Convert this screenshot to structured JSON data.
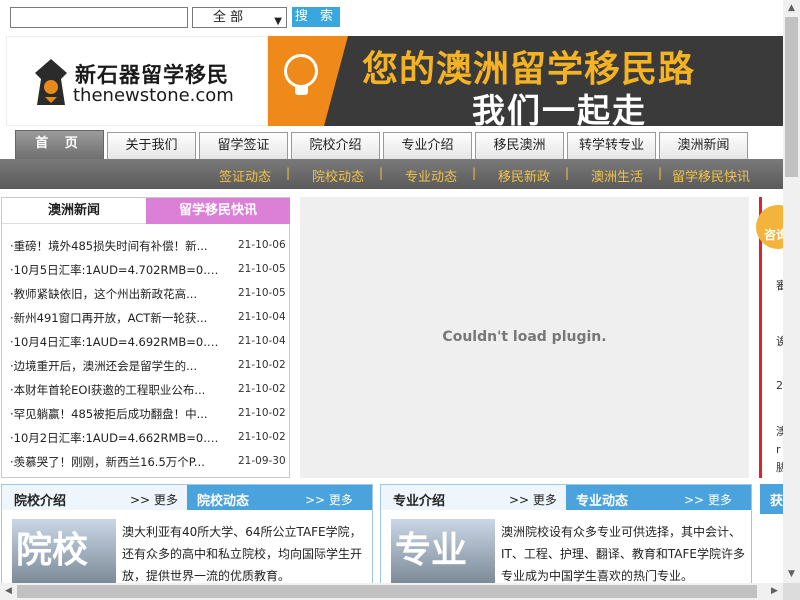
{
  "search": {
    "value": "",
    "select_value": "全 部",
    "button": "搜 索"
  },
  "banner": {
    "logo_cn": "新石器留学移民",
    "logo_en": "thenewstone.com",
    "slogan_line1": "您的澳洲留学移民路",
    "slogan_line2": "我们一起走"
  },
  "nav": {
    "tabs": [
      "首 页",
      "关于我们",
      "留学签证",
      "院校介绍",
      "专业介绍",
      "移民澳洲",
      "转学转专业",
      "澳洲新闻"
    ],
    "sub": [
      "签证动态",
      "院校动态",
      "专业动态",
      "移民新政",
      "澳洲生活",
      "留学移民快讯"
    ]
  },
  "news": {
    "tab_active": "澳洲新闻",
    "tab_other": "留学移民快讯",
    "items": [
      {
        "title": "·重磅！境外485损失时间有补偿！新...",
        "date": "21-10-06"
      },
      {
        "title": "·10月5日汇率:1AUD=4.702RMB=0.730...",
        "date": "21-10-05"
      },
      {
        "title": "·教师紧缺依旧，这个州出新政花高...",
        "date": "21-10-05"
      },
      {
        "title": "·新州491窗口再开放，ACT新一轮获...",
        "date": "21-10-04"
      },
      {
        "title": "·10月4日汇率:1AUD=4.692RMB=0.728...",
        "date": "21-10-04"
      },
      {
        "title": "·边境重开后，澳洲还会是留学生的...",
        "date": "21-10-02"
      },
      {
        "title": "·本财年首轮EOI获邀的工程职业公布...",
        "date": "21-10-02"
      },
      {
        "title": "·罕见躺赢！485被拒后成功翻盘！中...",
        "date": "21-10-02"
      },
      {
        "title": "·10月2日汇率:1AUD=4.662RMB=0.723...",
        "date": "21-10-02"
      },
      {
        "title": "·羡慕哭了！刚刚，新西兰16.5万个P...",
        "date": "21-09-30"
      }
    ]
  },
  "plugin": {
    "message": "Couldn't load plugin."
  },
  "consult": {
    "label": "咨询"
  },
  "right_strip": {
    "frags": [
      "審",
      "诶",
      "2",
      "澳",
      "r",
      "胁"
    ]
  },
  "box1": {
    "h1": "院校介绍",
    "h1_more": ">> 更多",
    "h2": "院校动态",
    "h2_more": ">> 更多",
    "img_text": "院校",
    "text": "澳大利亚有40所大学、64所公立TAFE学院，还有众多的高中和私立院校，均向国际学生开放，提供世界一流的优质教育。"
  },
  "box2": {
    "h1": "专业介绍",
    "h1_more": ">> 更多",
    "h2": "专业动态",
    "h2_more": ">> 更多",
    "img_text": "专业",
    "text": "澳洲院校设有众多专业可供选择，其中会计、IT、工程、护理、翻译、教育和TAFE学院许多专业成为中国学生喜欢的热门专业。"
  },
  "box3": {
    "h1": "获"
  }
}
